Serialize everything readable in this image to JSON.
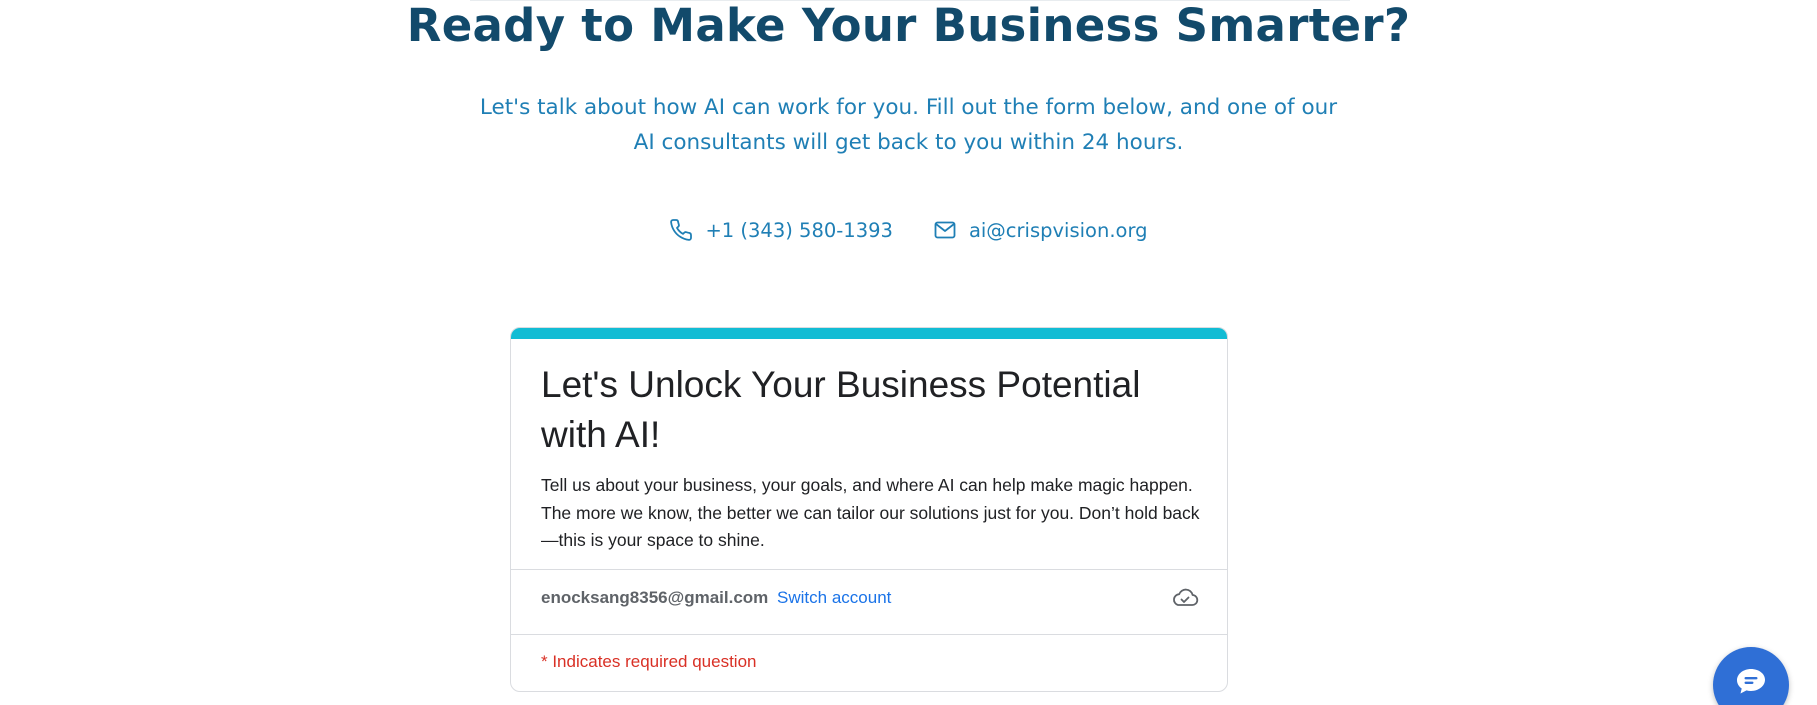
{
  "hero": {
    "headline": "Ready to Make Your Business Smarter?",
    "subtitle": "Let's talk about how AI can work for you. Fill out the form below, and one of our AI consultants will get back to you within 24 hours."
  },
  "contacts": {
    "phone": {
      "icon": "phone-icon",
      "text": "+1 (343) 580-1393"
    },
    "email": {
      "icon": "mail-icon",
      "text": "ai@crispvision.org"
    }
  },
  "form": {
    "title": "Let's Unlock Your Business Potential with AI!",
    "description": "Tell us about your business, your goals, and where AI can help make magic happen. The more we know, the better we can tailor our solutions just for you. Don’t hold back—this is your space to shine.",
    "account_email": "enocksang8356@gmail.com",
    "switch_account": "Switch account",
    "cloud_icon": "cloud-check-icon",
    "required_note": "* Indicates required question"
  },
  "chat": {
    "icon": "chat-bubble-icon"
  },
  "colors": {
    "headline": "#124a6b",
    "link_blue": "#1f7fb5",
    "form_accent": "#12bcd4",
    "google_blue": "#1a73e8",
    "required_red": "#d93025",
    "chat_button": "#2f6fd6"
  }
}
